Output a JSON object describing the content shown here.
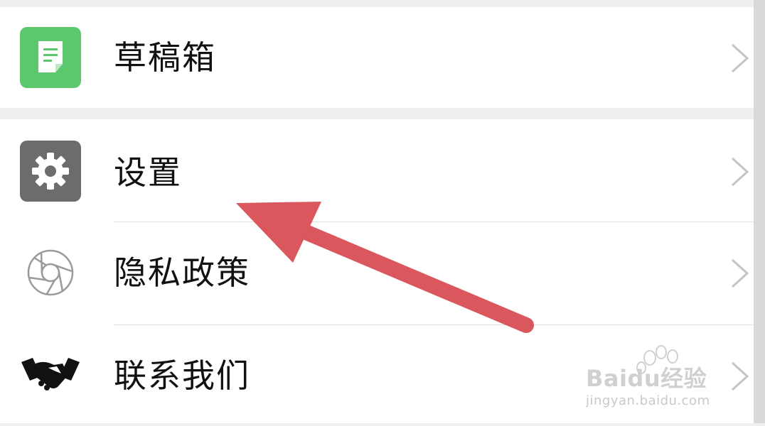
{
  "menu": {
    "items": [
      {
        "label": "草稿箱",
        "icon": "draft-box-icon",
        "icon_color": "#5cc86e"
      },
      {
        "label": "设置",
        "icon": "gear-icon",
        "icon_color": "#6c6c6c"
      },
      {
        "label": "隐私政策",
        "icon": "privacy-aperture-icon",
        "icon_color": "#9a9a9a"
      },
      {
        "label": "联系我们",
        "icon": "handshake-icon",
        "icon_color": "#111111"
      }
    ]
  },
  "annotation": {
    "arrow_color": "#d9575d",
    "points_to": "设置"
  },
  "watermark": {
    "brand": "Baidu经验",
    "url": "jingyan.baidu.com"
  }
}
